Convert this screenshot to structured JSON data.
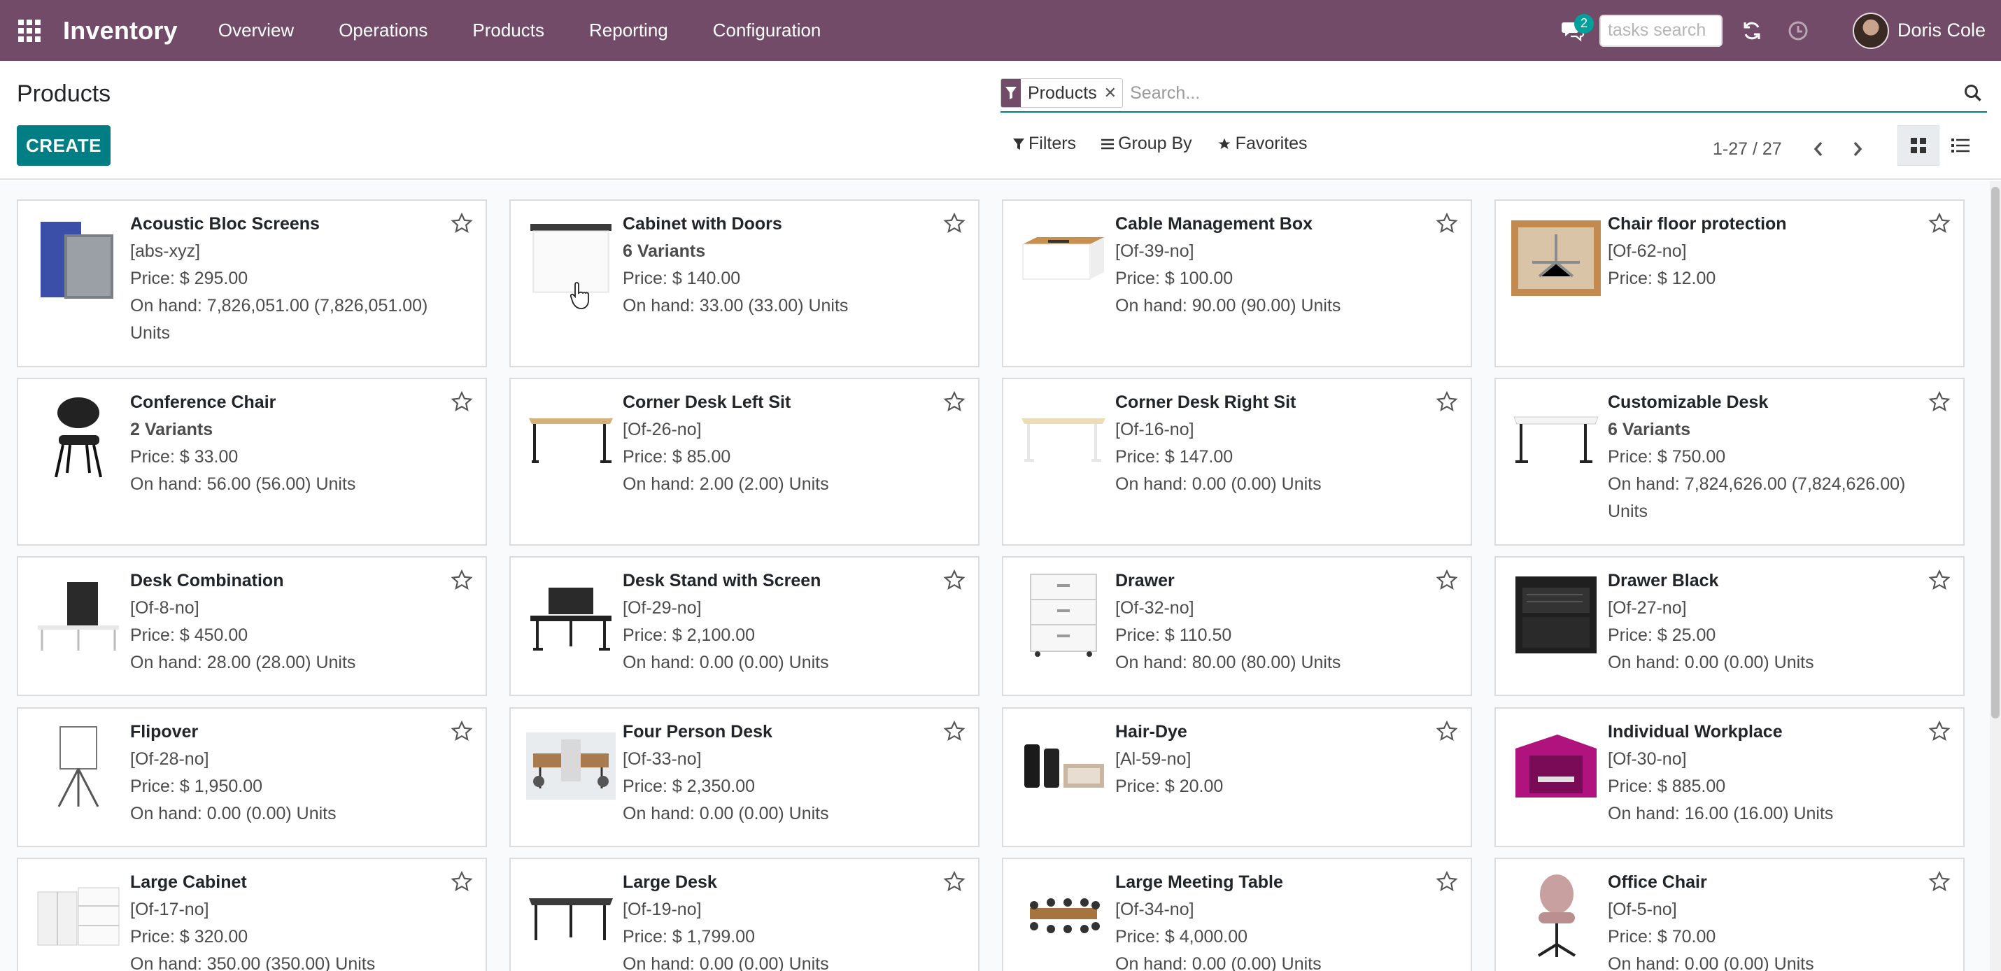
{
  "navbar": {
    "app_name": "Inventory",
    "menu": [
      "Overview",
      "Operations",
      "Products",
      "Reporting",
      "Configuration"
    ],
    "chat_count": "2",
    "tasks_search_placeholder": "tasks search",
    "user_name": "Doris Cole",
    "accent_color": "#714b67"
  },
  "control": {
    "title": "Products",
    "create_label": "CREATE",
    "facet_label": "Products",
    "search_placeholder": "Search...",
    "filters_label": "Filters",
    "groupby_label": "Group By",
    "favorites_label": "Favorites",
    "pager": "1-27 / 27",
    "primary_color": "#017e84"
  },
  "products": [
    {
      "name": "Acoustic Bloc Screens",
      "line2": "[abs-xyz]",
      "price": "Price: $ 295.00",
      "onhand": "On hand: 7,826,051.00 (7,826,051.00) Units",
      "variants": false,
      "img": "screens"
    },
    {
      "name": "Cabinet with Doors",
      "line2": "6 Variants",
      "price": "Price: $ 140.00",
      "onhand": "On hand: 33.00 (33.00) Units",
      "variants": true,
      "img": "cabinet"
    },
    {
      "name": "Cable Management Box",
      "line2": "[Of-39-no]",
      "price": "Price: $ 100.00",
      "onhand": "On hand: 90.00 (90.00) Units",
      "variants": false,
      "img": "cablebox"
    },
    {
      "name": "Chair floor protection",
      "line2": "[Of-62-no]",
      "price": "Price: $ 12.00",
      "onhand": "",
      "variants": false,
      "img": "floor"
    },
    {
      "name": "Conference Chair",
      "line2": "2 Variants",
      "price": "Price: $ 33.00",
      "onhand": "On hand: 56.00 (56.00) Units",
      "variants": true,
      "img": "chair"
    },
    {
      "name": "Corner Desk Left Sit",
      "line2": "[Of-26-no]",
      "price": "Price: $ 85.00",
      "onhand": "On hand: 2.00 (2.00) Units",
      "variants": false,
      "img": "desk-wood"
    },
    {
      "name": "Corner Desk Right Sit",
      "line2": "[Of-16-no]",
      "price": "Price: $ 147.00",
      "onhand": "On hand: 0.00 (0.00) Units",
      "variants": false,
      "img": "desk-light"
    },
    {
      "name": "Customizable Desk",
      "line2": "6 Variants",
      "price": "Price: $ 750.00",
      "onhand": "On hand: 7,824,626.00 (7,824,626.00) Units",
      "variants": true,
      "img": "desk-white"
    },
    {
      "name": "Desk Combination",
      "line2": "[Of-8-no]",
      "price": "Price: $ 450.00",
      "onhand": "On hand: 28.00 (28.00) Units",
      "variants": false,
      "img": "desk-combo"
    },
    {
      "name": "Desk Stand with Screen",
      "line2": "[Of-29-no]",
      "price": "Price: $ 2,100.00",
      "onhand": "On hand: 0.00 (0.00) Units",
      "variants": false,
      "img": "desk-screen"
    },
    {
      "name": "Drawer",
      "line2": "[Of-32-no]",
      "price": "Price: $ 110.50",
      "onhand": "On hand: 80.00 (80.00) Units",
      "variants": false,
      "img": "drawer"
    },
    {
      "name": "Drawer Black",
      "line2": "[Of-27-no]",
      "price": "Price: $ 25.00",
      "onhand": "On hand: 0.00 (0.00) Units",
      "variants": false,
      "img": "drawer-black"
    },
    {
      "name": "Flipover",
      "line2": "[Of-28-no]",
      "price": "Price: $ 1,950.00",
      "onhand": "On hand: 0.00 (0.00) Units",
      "variants": false,
      "img": "flipover"
    },
    {
      "name": "Four Person Desk",
      "line2": "[Of-33-no]",
      "price": "Price: $ 2,350.00",
      "onhand": "On hand: 0.00 (0.00) Units",
      "variants": false,
      "img": "four-desk"
    },
    {
      "name": "Hair-Dye",
      "line2": "[Al-59-no]",
      "price": "Price: $ 20.00",
      "onhand": "",
      "variants": false,
      "img": "hairdye"
    },
    {
      "name": "Individual Workplace",
      "line2": "[Of-30-no]",
      "price": "Price: $ 885.00",
      "onhand": "On hand: 16.00 (16.00) Units",
      "variants": false,
      "img": "workplace"
    },
    {
      "name": "Large Cabinet",
      "line2": "[Of-17-no]",
      "price": "Price: $ 320.00",
      "onhand": "On hand: 350.00 (350.00) Units",
      "variants": false,
      "img": "large-cabinet"
    },
    {
      "name": "Large Desk",
      "line2": "[Of-19-no]",
      "price": "Price: $ 1,799.00",
      "onhand": "On hand: 0.00 (0.00) Units",
      "variants": false,
      "img": "large-desk"
    },
    {
      "name": "Large Meeting Table",
      "line2": "[Of-34-no]",
      "price": "Price: $ 4,000.00",
      "onhand": "On hand: 0.00 (0.00) Units",
      "variants": false,
      "img": "meeting-table"
    },
    {
      "name": "Office Chair",
      "line2": "[Of-5-no]",
      "price": "Price: $ 70.00",
      "onhand": "On hand: 0.00 (0.00) Units",
      "variants": false,
      "img": "office-chair"
    }
  ]
}
